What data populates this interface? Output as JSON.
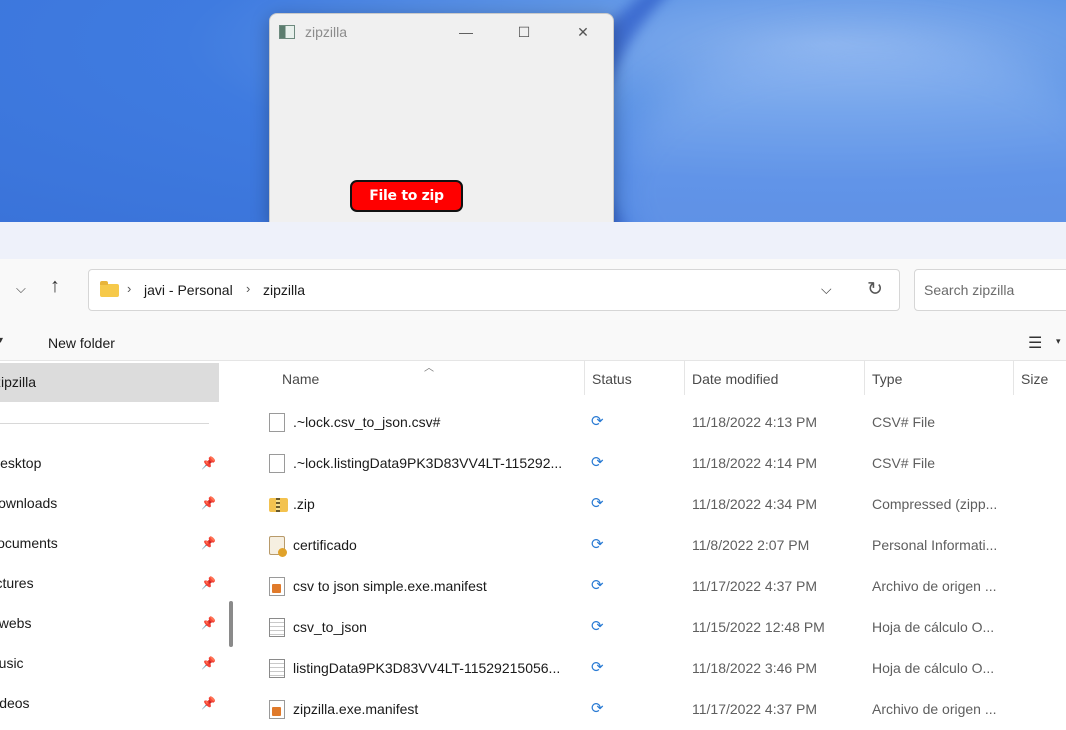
{
  "app_window": {
    "title": "zipzilla",
    "minimize_glyph": "—",
    "maximize_glyph": "☐",
    "close_glyph": "✕",
    "button_label": "File to zip",
    "button_color": "#ff0000"
  },
  "explorer": {
    "breadcrumb": [
      "javi - Personal",
      "zipzilla"
    ],
    "breadcrumb_sep": "›",
    "search_placeholder": "Search zipzilla",
    "new_folder_label": "New folder",
    "sidebar": {
      "selected": "zipzilla",
      "items": [
        "Desktop",
        "Downloads",
        "Documents",
        "Pictures",
        "qwebs",
        "Music",
        "Videos"
      ]
    },
    "columns": {
      "name": "Name",
      "status": "Status",
      "date": "Date modified",
      "type": "Type",
      "size": "Size"
    },
    "files": [
      {
        "name": ".~lock.csv_to_json.csv#",
        "icon": "doc-icon",
        "date": "11/18/2022 4:13 PM",
        "type": "CSV# File"
      },
      {
        "name": ".~lock.listingData9PK3D83VV4LT-115292...",
        "icon": "doc-icon",
        "date": "11/18/2022 4:14 PM",
        "type": "CSV# File"
      },
      {
        "name": ".zip",
        "icon": "zip-folder-icon",
        "date": "11/18/2022 4:34 PM",
        "type": "Compressed (zipp..."
      },
      {
        "name": "certificado",
        "icon": "certificate-icon",
        "date": "11/8/2022 2:07 PM",
        "type": "Personal Informati..."
      },
      {
        "name": "csv to json simple.exe.manifest",
        "icon": "manifest-icon",
        "date": "11/17/2022 4:37 PM",
        "type": "Archivo de origen ..."
      },
      {
        "name": "csv_to_json",
        "icon": "spreadsheet-icon",
        "date": "11/15/2022 12:48 PM",
        "type": "Hoja de cálculo O..."
      },
      {
        "name": "listingData9PK3D83VV4LT-11529215056...",
        "icon": "spreadsheet-icon",
        "date": "11/18/2022 3:46 PM",
        "type": "Hoja de cálculo O..."
      },
      {
        "name": "zipzilla.exe.manifest",
        "icon": "manifest-icon",
        "date": "11/17/2022 4:37 PM",
        "type": "Archivo de origen ..."
      }
    ],
    "status_icon_glyph": "⟳",
    "pin_glyph": "📌"
  }
}
